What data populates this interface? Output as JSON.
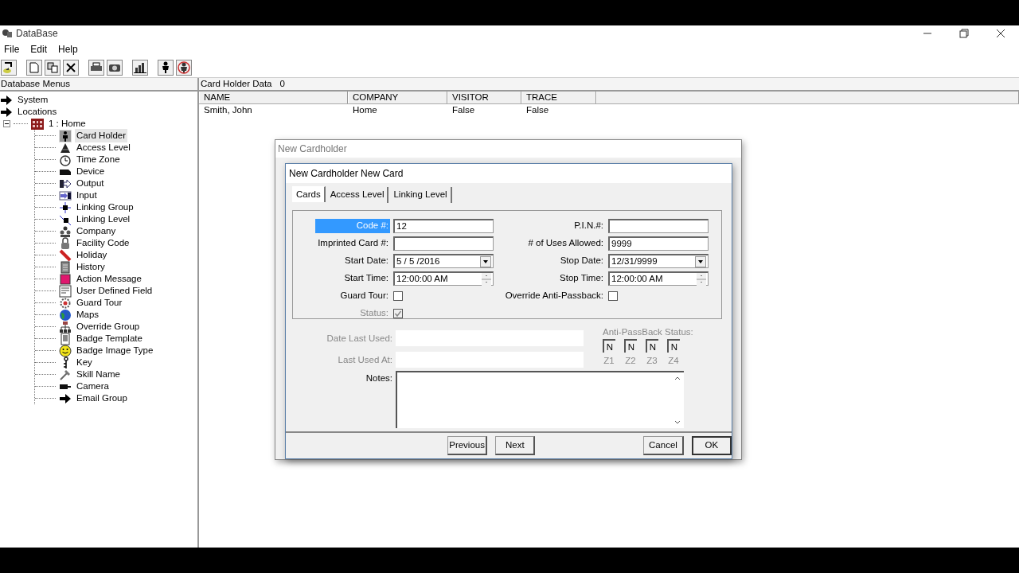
{
  "window": {
    "title": "DataBase"
  },
  "menu": [
    {
      "label": "File"
    },
    {
      "label": "Edit"
    },
    {
      "label": "Help"
    }
  ],
  "sidebar": {
    "title": "Database Menus",
    "tree": [
      {
        "label": "System"
      },
      {
        "label": "Locations"
      },
      {
        "label": "1 : Home",
        "expanded": true,
        "children": [
          {
            "label": "Card Holder",
            "selected": true
          },
          {
            "label": "Access Level",
            "selected": false
          },
          {
            "label": "Time Zone",
            "selected": false
          },
          {
            "label": "Device",
            "selected": false
          },
          {
            "label": "Output",
            "selected": false
          },
          {
            "label": "Input",
            "selected": false
          },
          {
            "label": "Linking Group",
            "selected": false
          },
          {
            "label": "Linking Level",
            "selected": false
          },
          {
            "label": "Company",
            "selected": false
          },
          {
            "label": "Facility Code",
            "selected": false
          },
          {
            "label": "Holiday",
            "selected": false
          },
          {
            "label": "History",
            "selected": false
          },
          {
            "label": "Action Message",
            "selected": false
          },
          {
            "label": "User Defined Field",
            "selected": false
          },
          {
            "label": "Guard Tour",
            "selected": false
          },
          {
            "label": "Maps",
            "selected": false
          },
          {
            "label": "Override Group",
            "selected": false
          },
          {
            "label": "Badge Template",
            "selected": false
          },
          {
            "label": "Badge Image Type",
            "selected": false
          },
          {
            "label": "Key",
            "selected": false
          },
          {
            "label": "Skill Name",
            "selected": false
          },
          {
            "label": "Camera",
            "selected": false
          },
          {
            "label": "Email Group",
            "selected": false
          }
        ]
      }
    ]
  },
  "panel": {
    "title": "Card Holder Data",
    "count": "0"
  },
  "table": {
    "columns": [
      "NAME",
      "COMPANY",
      "VISITOR",
      "TRACE"
    ],
    "rows": [
      [
        "Smith, John",
        "Home",
        "False",
        "False"
      ]
    ]
  },
  "outer_dialog": {
    "title": "New Cardholder"
  },
  "card_dialog": {
    "title": "New Cardholder New Card",
    "tabs": [
      {
        "label": "Cards",
        "selected": true
      },
      {
        "label": "Access Level",
        "selected": false
      },
      {
        "label": "Linking Level",
        "selected": false
      }
    ],
    "left_fields": [
      {
        "kind": "text",
        "label": "Code #:",
        "value": "12",
        "highlighted": true
      },
      {
        "kind": "text",
        "label": "Imprinted Card #:",
        "highlighted": false
      },
      {
        "kind": "date",
        "label": "Start Date:",
        "value": "5 / 5 /2016",
        "highlighted": false
      },
      {
        "kind": "time",
        "label": "Start Time:",
        "value": "12:00:00 AM",
        "highlighted": false
      },
      {
        "kind": "checkbox",
        "label": "Guard Tour:",
        "checked": false,
        "disabled": false
      },
      {
        "kind": "checkbox",
        "label": "Status:",
        "checked": true,
        "disabled": true
      }
    ],
    "right_fields": [
      {
        "kind": "text",
        "label": "P.I.N.#:",
        "highlighted": false
      },
      {
        "kind": "text",
        "label": "# of Uses Allowed:",
        "value": "9999",
        "highlighted": false
      },
      {
        "kind": "date",
        "label": "Stop Date:",
        "value": "12/31/9999",
        "highlighted": false
      },
      {
        "kind": "time",
        "label": "Stop Time:",
        "value": "12:00:00 AM",
        "highlighted": false
      },
      {
        "kind": "checkbox",
        "label": "Override Anti-Passback:",
        "checked": false,
        "disabled": false
      }
    ],
    "usage_fields": [
      {
        "label": "Date Last Used:"
      },
      {
        "label": "Last Used At:"
      }
    ],
    "anti_passback": {
      "title": "Anti-PassBack Status:",
      "zones": [
        {
          "value": "N",
          "label": "Z1"
        },
        {
          "value": "N",
          "label": "Z2"
        },
        {
          "value": "N",
          "label": "Z3"
        },
        {
          "value": "N",
          "label": "Z4"
        }
      ]
    },
    "notes": {
      "label": "Notes:"
    },
    "buttons": [
      {
        "label": "Previous",
        "default": false
      },
      {
        "label": "Next",
        "default": false
      },
      {
        "label": "Cancel",
        "default": false
      },
      {
        "label": "OK",
        "default": true
      }
    ]
  }
}
